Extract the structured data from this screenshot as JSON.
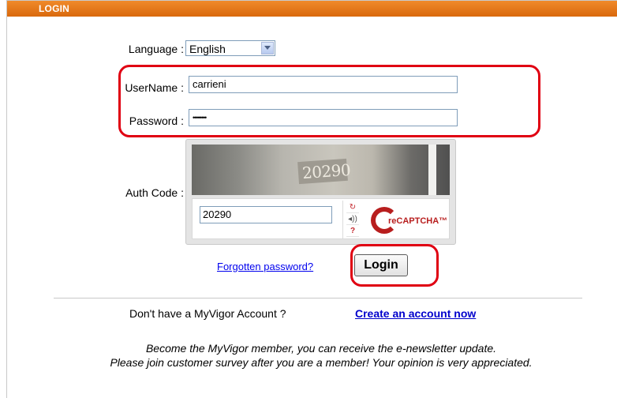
{
  "header": {
    "title": "LOGIN"
  },
  "form": {
    "language_label": "Language :",
    "language_value": "English",
    "username_label": "UserName :",
    "username_value": "carrieni",
    "password_label": "Password :",
    "password_value": "••••••••",
    "auth_label": "Auth Code :"
  },
  "captcha": {
    "image_text": "20290",
    "input_value": "20290",
    "logo_text": "reCAPTCHA™"
  },
  "actions": {
    "forgot_link": "Forgotten password?",
    "login_button": "Login"
  },
  "signup": {
    "prompt": "Don't have a MyVigor Account ?",
    "create_link": "Create an account now"
  },
  "messages": {
    "line1": "Become the MyVigor member, you can receive the e-newsletter update.",
    "line2": "Please join customer survey after you are a member! Your opinion is very appreciated."
  },
  "colors": {
    "header": "#e8791c",
    "highlight": "#e00012",
    "link": "#0000cc"
  },
  "icons": [
    "dropdown-arrow-icon",
    "refresh-icon",
    "audio-icon",
    "help-icon",
    "recaptcha-logo-icon"
  ]
}
